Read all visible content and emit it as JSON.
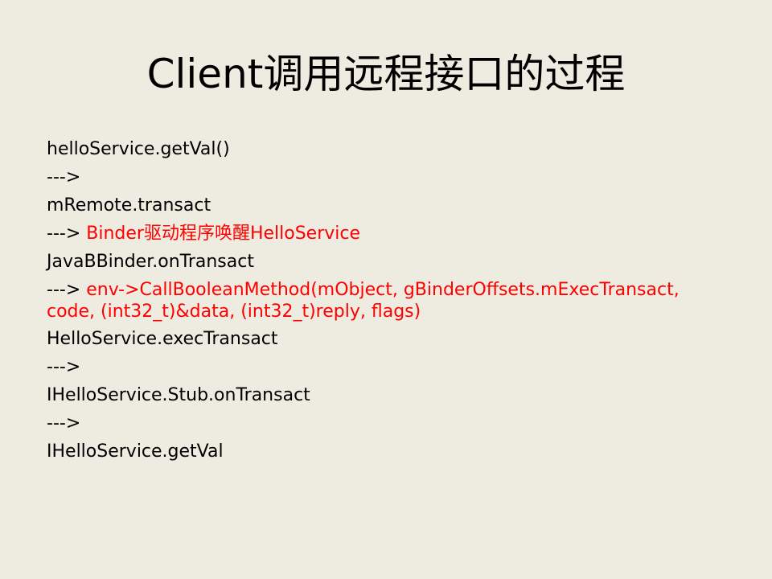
{
  "slide": {
    "title": "Client调用远程接口的过程",
    "lines": [
      {
        "text": "helloService.getVal()"
      },
      {
        "text": "--->"
      },
      {
        "text": "mRemote.transact"
      },
      {
        "prefix": "---> ",
        "highlight": "Binder驱动程序唤醒HelloService"
      },
      {
        "text": "JavaBBinder.onTransact"
      },
      {
        "prefix": "---> ",
        "highlight": "env->CallBooleanMethod(mObject,  gBinderOffsets.mExecTransact,"
      },
      {
        "highlight": "code, (int32_t)&data, (int32_t)reply, flags)"
      },
      {
        "text": "HelloService.execTransact"
      },
      {
        "text": "--->"
      },
      {
        "text": "IHelloService.Stub.onTransact"
      },
      {
        "text": "--->"
      },
      {
        "text": "IHelloService.getVal"
      }
    ],
    "colors": {
      "background": "#eeece1",
      "text": "#000000",
      "highlight": "#ff0000"
    }
  }
}
